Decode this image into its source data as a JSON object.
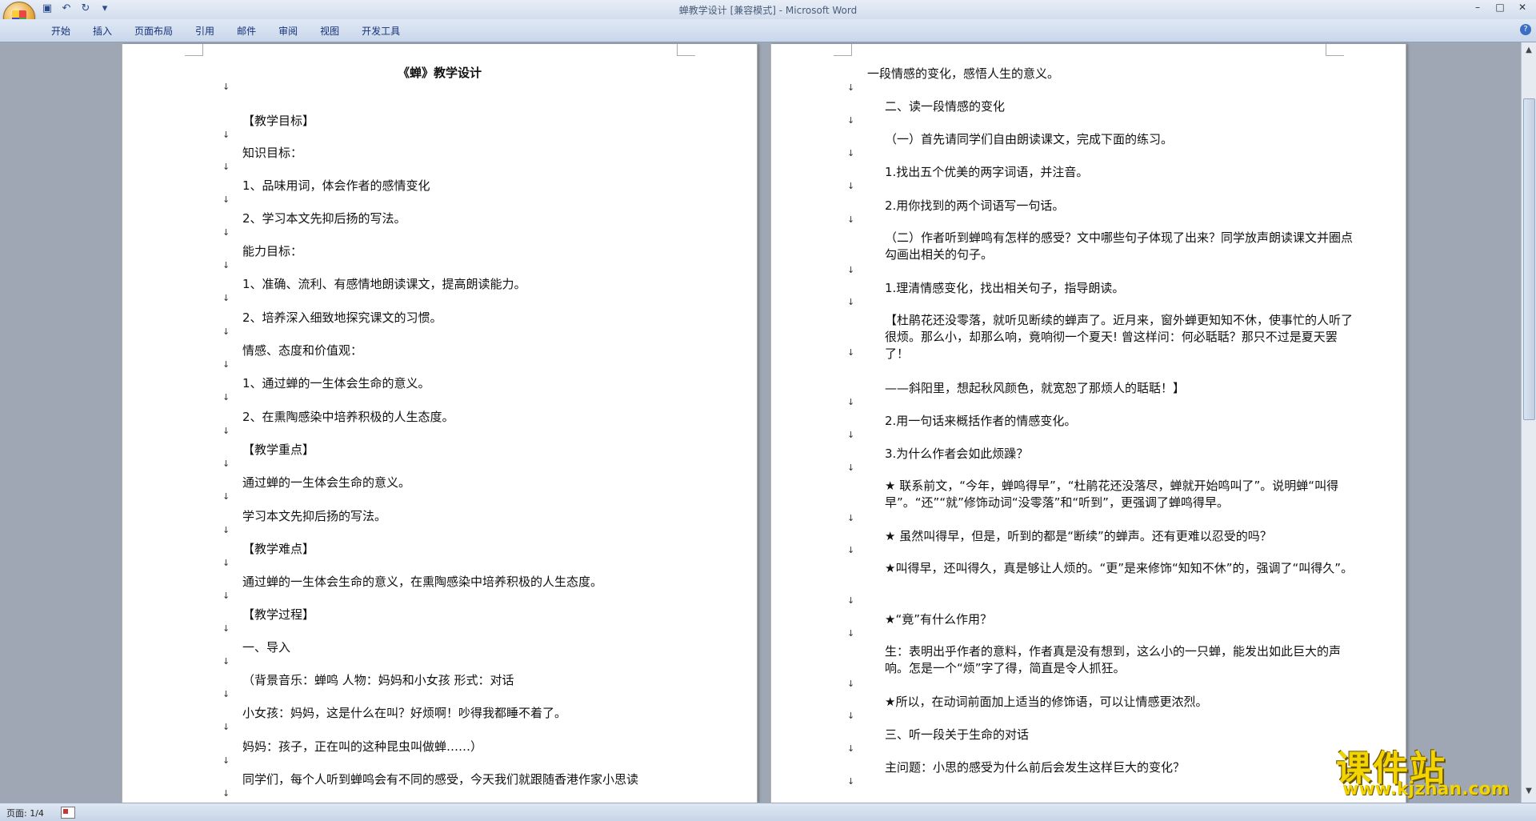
{
  "app": {
    "window_title": "蝉教学设计 [兼容模式] - Microsoft Word",
    "tabs": [
      "开始",
      "插入",
      "页面布局",
      "引用",
      "邮件",
      "审阅",
      "视图",
      "开发工具"
    ],
    "status_page": "页面: 1/4"
  },
  "left_page": [
    {
      "text": "《蝉》教学设计",
      "bold": true
    },
    {
      "text": "【教学目标】"
    },
    {
      "text": "知识目标："
    },
    {
      "text": "1、品味用词，体会作者的感情变化"
    },
    {
      "text": "2、学习本文先抑后扬的写法。"
    },
    {
      "text": "能力目标："
    },
    {
      "text": "1、准确、流利、有感情地朗读课文，提高朗读能力。"
    },
    {
      "text": "2、培养深入细致地探究课文的习惯。"
    },
    {
      "text": "情感、态度和价值观："
    },
    {
      "text": "1、通过蝉的一生体会生命的意义。"
    },
    {
      "text": "2、在熏陶感染中培养积极的人生态度。"
    },
    {
      "text": "【教学重点】"
    },
    {
      "text": " 通过蝉的一生体会生命的意义。"
    },
    {
      "text": "学习本文先抑后扬的写法。"
    },
    {
      "text": "【教学难点】"
    },
    {
      "text": "  通过蝉的一生体会生命的意义，在熏陶感染中培养积极的人生态度。"
    },
    {
      "text": "【教学过程】"
    },
    {
      "text": "一、导入"
    },
    {
      "text": "（背景音乐：蝉鸣     人物：妈妈和小女孩     形式：对话"
    },
    {
      "text": "小女孩：妈妈，这是什么在叫？好烦啊！吵得我都睡不着了。"
    },
    {
      "text": "妈妈：孩子，正在叫的这种昆虫叫做蝉……）"
    },
    {
      "text": " 同学们，每个人听到蝉鸣会有不同的感受，今天我们就跟随香港作家小思读"
    }
  ],
  "right_page": [
    {
      "text": "一段情感的变化，感悟人生的意义。"
    },
    {
      "text": "二、读一段情感的变化"
    },
    {
      "text": "（一）首先请同学们自由朗读课文，完成下面的练习。"
    },
    {
      "text": "1.找出五个优美的两字词语，并注音。"
    },
    {
      "text": "2.用你找到的两个词语写一句话。"
    },
    {
      "text": "（二）作者听到蝉鸣有怎样的感受？文中哪些句子体现了出来？同学放声朗读课文并圈点勾画出相关的句子。"
    },
    {
      "text": "1.理清情感变化，找出相关句子，指导朗读。"
    },
    {
      "text": "【杜鹃花还没零落，就听见断续的蝉声了。近月来，窗外蝉更知知不休，使事忙的人听了很烦。那么小，却那么响，竟响彻一个夏天! 曾这样问：何必聒聒？那只不过是夏天罢了！"
    },
    {
      "text": "——斜阳里，想起秋风颜色，就宽恕了那烦人的聒聒！】"
    },
    {
      "text": "2.用一句话来概括作者的情感变化。"
    },
    {
      "text": "3.为什么作者会如此烦躁？"
    },
    {
      "text": "★ 联系前文，“今年，蝉鸣得早”，“杜鹃花还没落尽，蝉就开始鸣叫了”。说明蝉“叫得早”。“还”“就”修饰动词“没零落”和“听到”，更强调了蝉鸣得早。"
    },
    {
      "text": "★ 虽然叫得早，但是，听到的都是“断续”的蝉声。还有更难以忍受的吗？"
    },
    {
      "text": "★叫得早，还叫得久，真是够让人烦的。“更”是来修饰“知知不休”的，强调了“叫得久”。"
    },
    {
      "text": "★“竟”有什么作用？"
    },
    {
      "text": "生：表明出乎作者的意料，作者真是没有想到，这么小的一只蝉，能发出如此巨大的声响。怎是一个“烦”字了得，简直是令人抓狂。"
    },
    {
      "text": "★所以，在动词前面加上适当的修饰语，可以让情感更浓烈。"
    },
    {
      "text": "三、听一段关于生命的对话"
    },
    {
      "text": "主问题：小思的感受为什么前后会发生这样巨大的变化？"
    }
  ],
  "watermark": {
    "title": "课件站",
    "url": "www.kjzhan.com"
  }
}
